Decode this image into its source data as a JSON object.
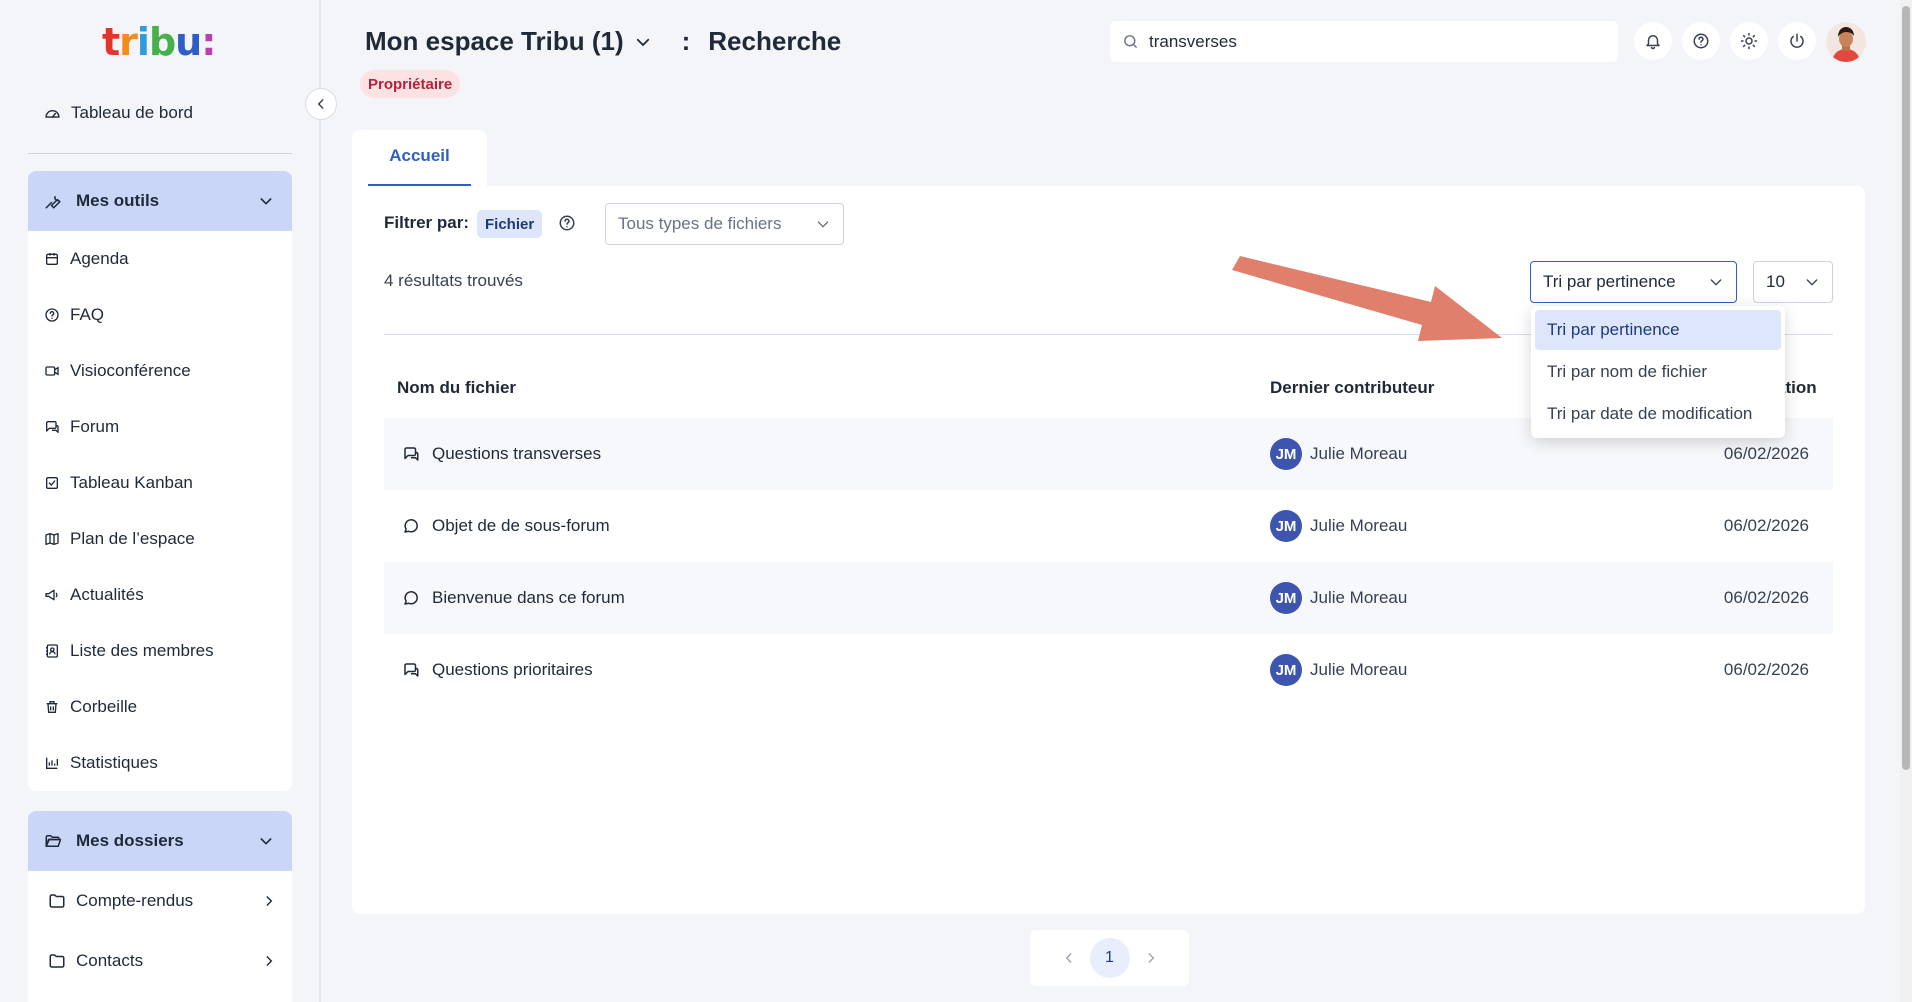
{
  "app": {
    "logo_text": "tribu:",
    "colors": {
      "accent": "#2f5fc4",
      "sidebar_head": "#c9d6f7",
      "badge_bg": "#fde2e4",
      "badge_text": "#b4233a",
      "initials_bg": "#3e55b0"
    }
  },
  "sidebar": {
    "dashboard_label": "Tableau de bord",
    "tools": {
      "title": "Mes outils",
      "items": [
        {
          "label": "Agenda",
          "icon": "calendar-icon"
        },
        {
          "label": "FAQ",
          "icon": "help-circle-icon"
        },
        {
          "label": "Visioconférence",
          "icon": "video-icon"
        },
        {
          "label": "Forum",
          "icon": "forum-icon"
        },
        {
          "label": "Tableau Kanban",
          "icon": "checkbox-icon"
        },
        {
          "label": "Plan de l’espace",
          "icon": "map-icon"
        },
        {
          "label": "Actualités",
          "icon": "megaphone-icon"
        },
        {
          "label": "Liste des membres",
          "icon": "contacts-icon"
        },
        {
          "label": "Corbeille",
          "icon": "trash-icon"
        },
        {
          "label": "Statistiques",
          "icon": "chart-icon"
        }
      ]
    },
    "folders": {
      "title": "Mes dossiers",
      "items": [
        {
          "label": "Compte-rendus"
        },
        {
          "label": "Contacts"
        }
      ]
    }
  },
  "header": {
    "space_name": "Mon espace Tribu (1)",
    "separator": ":",
    "page": "Recherche",
    "role_badge": "Propriétaire",
    "search": {
      "value": "transverses",
      "placeholder": ""
    }
  },
  "tabs": [
    {
      "label": "Accueil",
      "active": true
    }
  ],
  "filters": {
    "label": "Filtrer par:",
    "chip": "Fichier",
    "file_types": "Tous types de fichiers"
  },
  "results": {
    "count_text": "4 résultats trouvés",
    "sort_selected": "Tri par pertinence",
    "page_size": "10",
    "sort_options": [
      {
        "label": "Tri par pertinence",
        "selected": true
      },
      {
        "label": "Tri par nom de fichier",
        "selected": false
      },
      {
        "label": "Tri par date de modification",
        "selected": false
      }
    ]
  },
  "table": {
    "headers": {
      "file": "Nom du fichier",
      "contributor": "Dernier contributeur",
      "date_partial": "ation"
    },
    "rows": [
      {
        "file": "Questions transverses",
        "icon": "forum-icon",
        "initials": "JM",
        "contributor": "Julie Moreau",
        "date": "06/02/2026"
      },
      {
        "file": "Objet de de sous-forum",
        "icon": "chat-bubble-icon",
        "initials": "JM",
        "contributor": "Julie Moreau",
        "date": "06/02/2026"
      },
      {
        "file": "Bienvenue dans ce forum",
        "icon": "chat-bubble-icon",
        "initials": "JM",
        "contributor": "Julie Moreau",
        "date": "06/02/2026"
      },
      {
        "file": "Questions prioritaires",
        "icon": "forum-icon",
        "initials": "JM",
        "contributor": "Julie Moreau",
        "date": "06/02/2026"
      }
    ]
  },
  "pagination": {
    "current": "1"
  }
}
